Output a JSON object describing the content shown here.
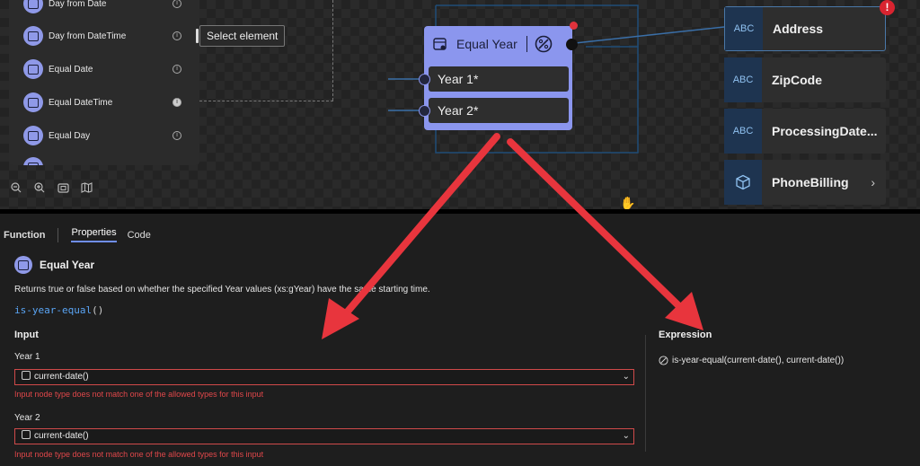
{
  "function_list": {
    "items": [
      {
        "label": "Day from Date",
        "info": "i"
      },
      {
        "label": "Day from DateTime",
        "info": "i"
      },
      {
        "label": "Equal Date",
        "info": "i"
      },
      {
        "label": "Equal DateTime",
        "info": "i"
      },
      {
        "label": "Equal Day",
        "info": "i"
      }
    ]
  },
  "tooltip": "Select element",
  "node": {
    "title": "Equal Year",
    "inputs": [
      "Year 1*",
      "Year 2*"
    ]
  },
  "schema_nodes": [
    {
      "icon": "ABC",
      "label": "Address",
      "has_error": true
    },
    {
      "icon": "ABC",
      "label": "ZipCode"
    },
    {
      "icon": "ABC",
      "label": "ProcessingDate..."
    },
    {
      "icon": "cube-icon",
      "label": "PhoneBilling",
      "chevron": "›"
    }
  ],
  "error_badge": "!",
  "tabs": [
    "Function",
    "Properties",
    "Code"
  ],
  "details": {
    "title": "Equal Year",
    "description": "Returns true or false based on whether the specified Year values (xs:gYear) have the same starting time.",
    "signature_name": "is-year-equal",
    "signature_parens": "()",
    "input_heading": "Input",
    "fields": [
      {
        "label": "Year 1",
        "value": "current-date()",
        "error": "Input node type does not match one of the allowed types for this input"
      },
      {
        "label": "Year 2",
        "value": "current-date()",
        "error": "Input node type does not match one of the allowed types for this input"
      }
    ],
    "expression_heading": "Expression",
    "expression": "is-year-equal(current-date(), current-date())"
  },
  "colors": {
    "accent": "#8b96ee",
    "error": "#e0474a",
    "annotation": "#e8353d"
  }
}
